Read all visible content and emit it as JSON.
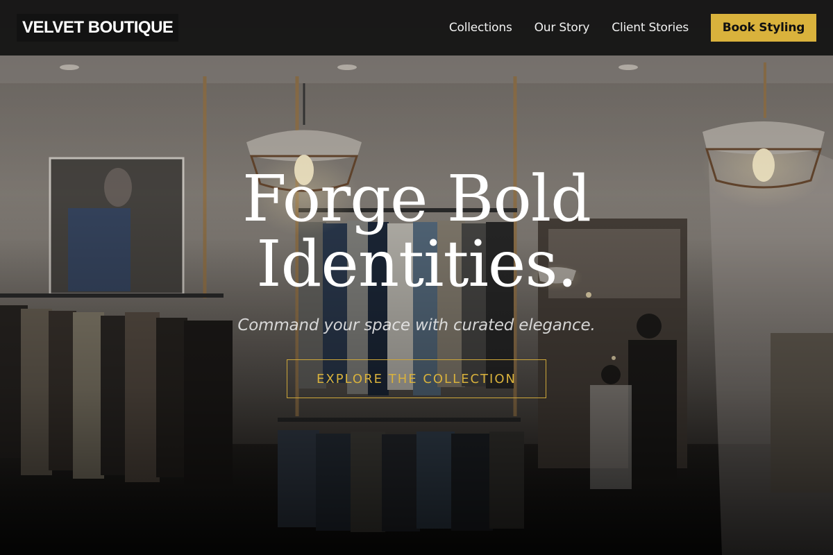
{
  "brand": {
    "name": "VELVET BOUTIQUE"
  },
  "nav": {
    "links": [
      "Collections",
      "Our Story",
      "Client Stories"
    ],
    "cta_label": "Book Styling"
  },
  "hero": {
    "title_line1": "Forge Bold",
    "title_line2": "Identities.",
    "subtitle": "Command your space with curated elegance.",
    "button_label": "EXPLORE THE COLLECTION"
  },
  "colors": {
    "accent": "#d9b23c",
    "nav_background": "#0a0a0a",
    "text": "#ffffff"
  },
  "icons": [
    "pendant-lamp-icon"
  ]
}
